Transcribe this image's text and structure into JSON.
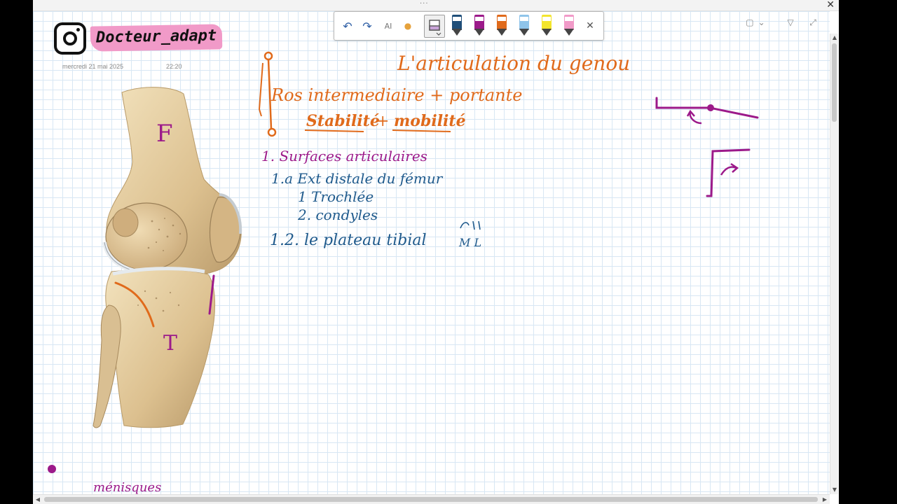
{
  "titlebar": {
    "drag_handle": "···",
    "close": "✕"
  },
  "brand": {
    "name": "Docteur_adapt",
    "date": "mercredi 21 mai 2025",
    "time": "22:20"
  },
  "toolbar": {
    "undo": "↶",
    "redo": "↷",
    "ai_label": "AI",
    "dot": "●",
    "close": "✕",
    "pens": [
      {
        "name": "pen-dark-blue",
        "color": "#1f4e79"
      },
      {
        "name": "pen-purple",
        "color": "#9c1a8a"
      },
      {
        "name": "pen-orange",
        "color": "#e06a1b"
      },
      {
        "name": "pen-light-blue",
        "color": "#8fc4ea"
      },
      {
        "name": "highlighter-yellow",
        "color": "#f3e52c"
      },
      {
        "name": "highlighter-pink",
        "color": "#f19ac8"
      }
    ]
  },
  "window_controls": {
    "layout": "▢",
    "chevron": "⌄",
    "pen_mode": "▽",
    "expand": "⤢"
  },
  "notes": {
    "title": "L'articulation du genou",
    "line1": "Ros intermediaire + portante",
    "line2_a": "Stabilité",
    "line2_plus": "+",
    "line2_b": "mobilité",
    "section1": "1. Surfaces articulaires",
    "item_1a": "1.a Ext distale du fémur",
    "item_trochlee": "1 Trochlée",
    "item_condyles": "2. condyles",
    "item_plateau": "1.2. le plateau tibial",
    "item_plateau_note": "M L",
    "femur_label": "F",
    "tibia_label": "T",
    "bottom_note": "ménisques"
  },
  "colors": {
    "orange_ink": "#e06a1b",
    "blue_ink": "#1f5a8c",
    "purple_ink": "#9c1a8a",
    "brand_pink": "#f19ac8",
    "grid": "#d8e7f4"
  },
  "scroll": {
    "up": "▲",
    "down": "▼",
    "left": "◀",
    "right": "▶"
  }
}
